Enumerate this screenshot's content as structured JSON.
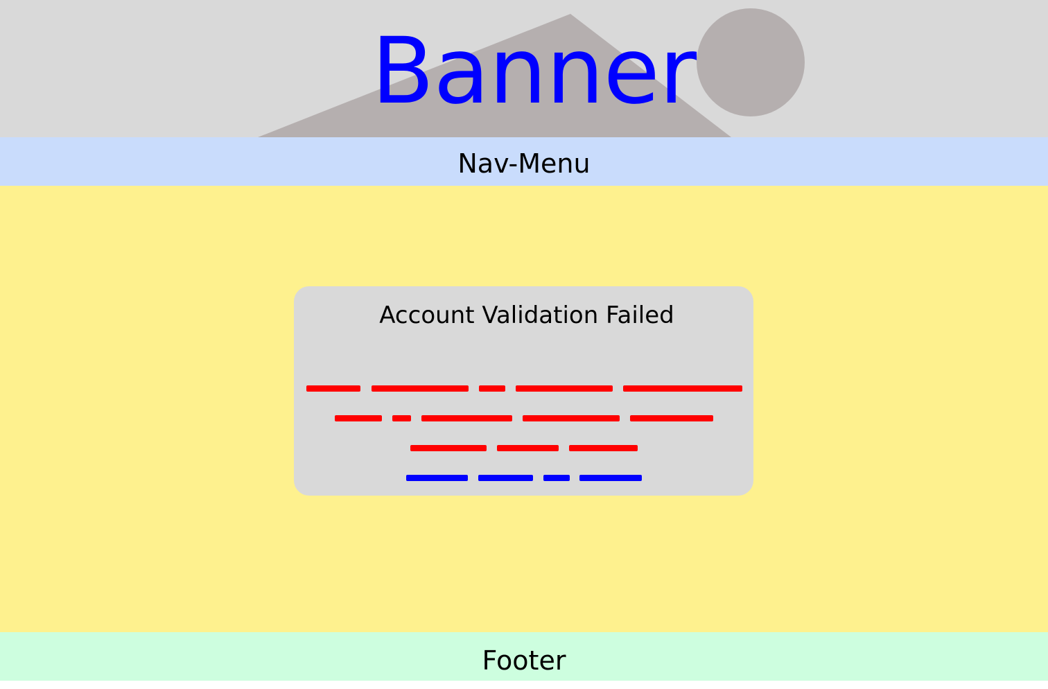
{
  "banner": {
    "title": "Banner",
    "title_color": "#0000ff",
    "background_color": "#d9d9d9",
    "illustration_color": "#b5afaf"
  },
  "nav": {
    "label": "Nav-Menu",
    "background_color": "#c9dcfc"
  },
  "main": {
    "background_color": "#fef18e",
    "dialog": {
      "title": "Account Validation Failed",
      "background_color": "#d9d9d9",
      "placeholder_text_lines": [
        {
          "color": "#ff0000",
          "word_count": 5
        },
        {
          "color": "#ff0000",
          "word_count": 5
        },
        {
          "color": "#ff0000",
          "word_count": 3
        },
        {
          "color": "#0000ff",
          "word_count": 4
        }
      ]
    }
  },
  "footer": {
    "label": "Footer",
    "background_color": "#cdfedf"
  }
}
